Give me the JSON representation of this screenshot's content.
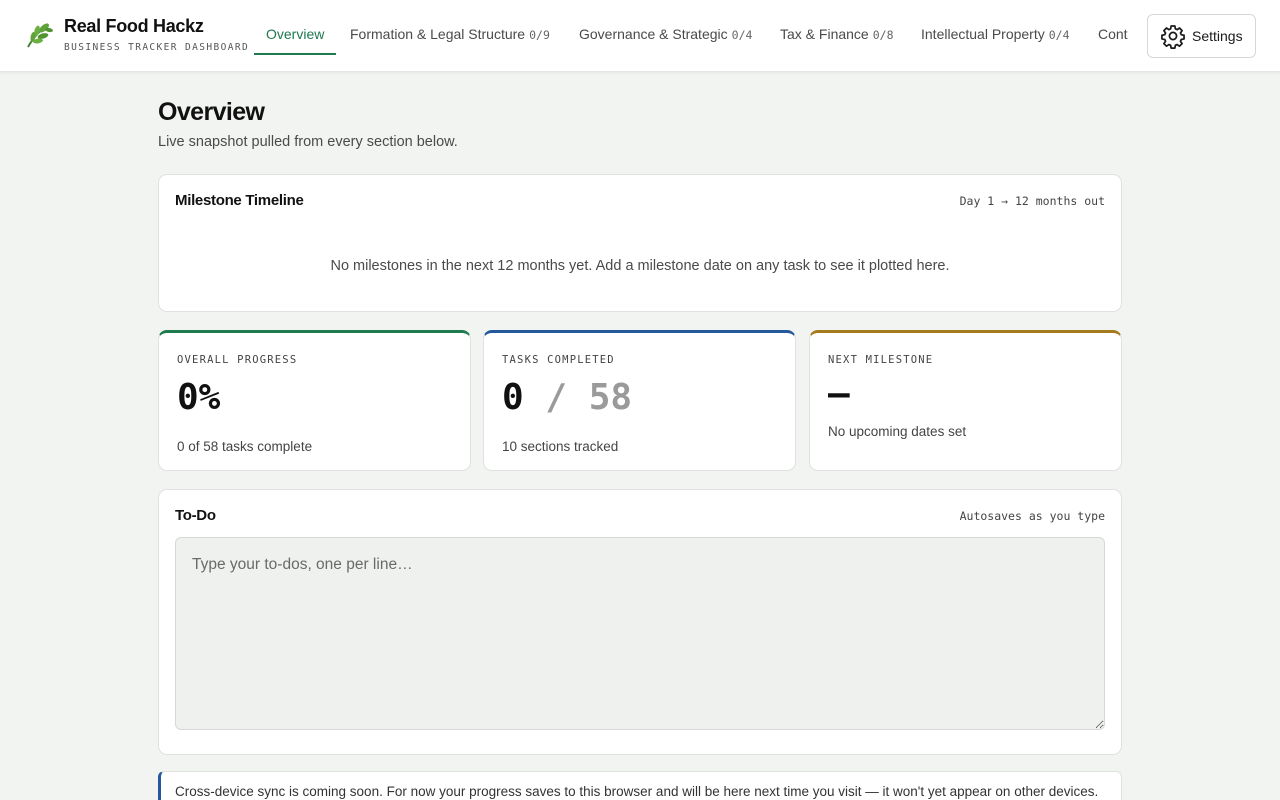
{
  "header": {
    "title": "Real Food Hackz",
    "subtitle": "BUSINESS TRACKER DASHBOARD",
    "logo_icon": "leaf-icon",
    "settings_label": "Settings"
  },
  "nav": {
    "tabs": [
      {
        "label": "Overview",
        "count": "",
        "active": true
      },
      {
        "label": "Formation & Legal Structure",
        "count": "0/9"
      },
      {
        "label": "Governance & Strategic",
        "count": "0/4"
      },
      {
        "label": "Tax & Finance",
        "count": "0/8"
      },
      {
        "label": "Intellectual Property",
        "count": "0/4"
      },
      {
        "label": "Cont",
        "count": ""
      }
    ]
  },
  "page": {
    "title": "Overview",
    "subtitle": "Live snapshot pulled from every section below."
  },
  "timeline": {
    "title": "Milestone Timeline",
    "range": "Day 1 → 12 months out",
    "empty_message": "No milestones in the next 12 months yet. Add a milestone date on any task to see it plotted here."
  },
  "stats": {
    "progress": {
      "label": "OVERALL PROGRESS",
      "value": "0%",
      "note": "0 of 58 tasks complete",
      "accent": "#1e7a4f"
    },
    "tasks": {
      "label": "TASKS COMPLETED",
      "value": "0",
      "total": "/ 58",
      "note": "10 sections tracked",
      "accent": "#24589a"
    },
    "milestone": {
      "label": "NEXT MILESTONE",
      "value": "–",
      "note": "No upcoming dates set",
      "accent": "#a47a1c"
    }
  },
  "todo": {
    "title": "To-Do",
    "meta": "Autosaves as you type",
    "placeholder": "Type your to-dos, one per line…"
  },
  "notice": {
    "text": "Cross-device sync is coming soon. For now your progress saves to this browser and will be here next time you visit — it won't yet appear on other devices."
  }
}
